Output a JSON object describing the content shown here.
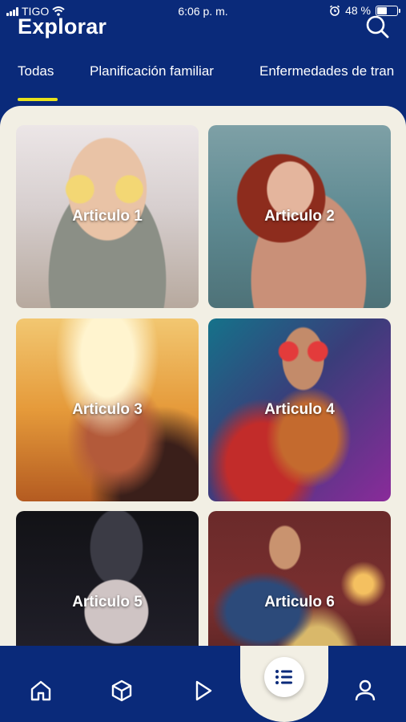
{
  "status_bar": {
    "carrier": "TIGO",
    "time": "6:06 p. m.",
    "battery": "48 %",
    "battery_level": 0.48
  },
  "header": {
    "title": "Explorar",
    "search_icon": "search-icon"
  },
  "tabs": [
    {
      "label": "Todas",
      "active": true
    },
    {
      "label": "Planificación familiar",
      "active": false
    },
    {
      "label": "Enfermedades de tran",
      "active": false
    }
  ],
  "articles": [
    {
      "label": "Articulo 1"
    },
    {
      "label": "Articulo 2"
    },
    {
      "label": "Articulo 3"
    },
    {
      "label": "Articulo 4"
    },
    {
      "label": "Articulo 5"
    },
    {
      "label": "Articulo 6"
    }
  ],
  "bottom_nav": [
    {
      "icon": "home-icon"
    },
    {
      "icon": "cube-icon"
    },
    {
      "icon": "play-icon"
    },
    {
      "icon": "list-icon",
      "active": true
    },
    {
      "icon": "user-icon"
    }
  ],
  "colors": {
    "primary": "#0a2a7a",
    "accent": "#e8e21a",
    "panel": "#f2efe4"
  }
}
